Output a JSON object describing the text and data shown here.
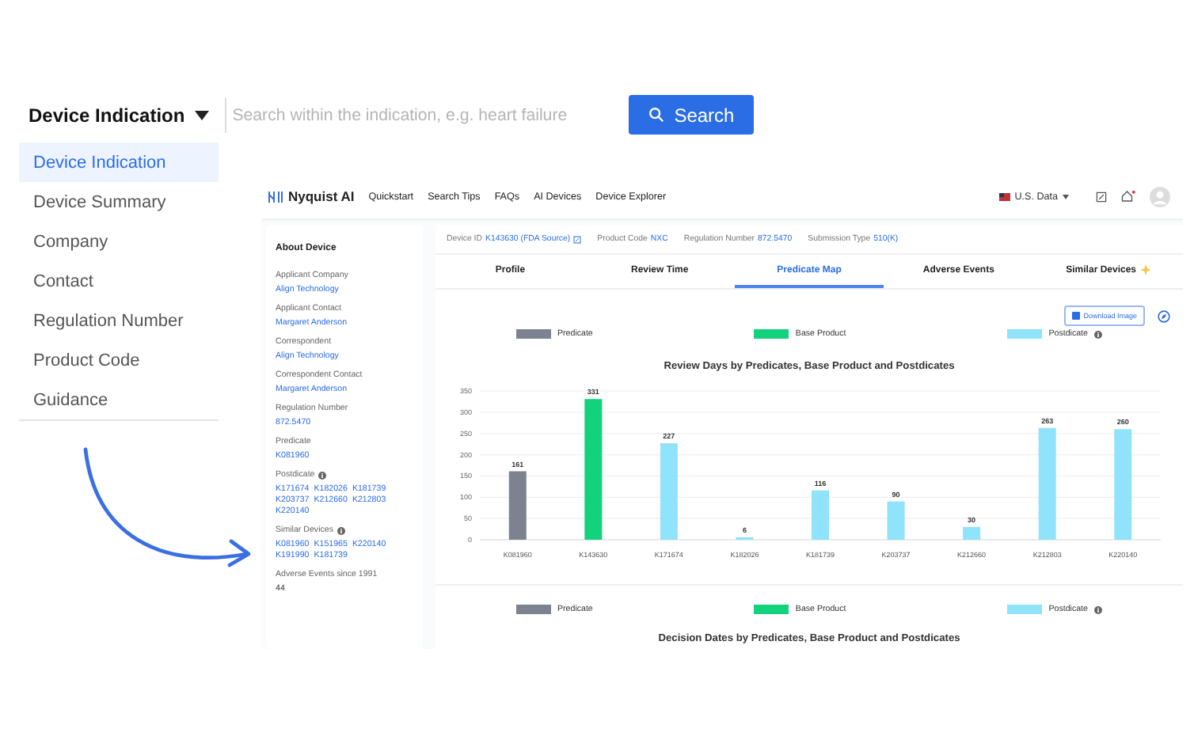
{
  "search_bar": {
    "scope": "Device Indication",
    "placeholder": "Search within the indication, e.g. heart failure",
    "button": "Search"
  },
  "scope_menu": [
    {
      "label": "Device Indication",
      "selected": true
    },
    {
      "label": "Device Summary",
      "selected": false
    },
    {
      "label": "Company",
      "selected": false
    },
    {
      "label": "Contact",
      "selected": false
    },
    {
      "label": "Regulation Number",
      "selected": false
    },
    {
      "label": "Product Code",
      "selected": false
    },
    {
      "label": "Guidance",
      "selected": false
    }
  ],
  "app": {
    "logo": "Nyquist AI",
    "nav": [
      "Quickstart",
      "Search Tips",
      "FAQs",
      "AI Devices",
      "Device Explorer"
    ],
    "region": "U.S. Data",
    "device_bar": [
      {
        "label": "Device ID",
        "value": "K143630 (FDA Source)",
        "external": true
      },
      {
        "label": "Product Code",
        "value": "NXC",
        "external": false
      },
      {
        "label": "Regulation Number",
        "value": "872.5470",
        "external": false
      },
      {
        "label": "Submission Type",
        "value": "510(K)",
        "external": false
      }
    ],
    "tabs": [
      {
        "label": "Profile",
        "selected": false,
        "new": false
      },
      {
        "label": "Review Time",
        "selected": false,
        "new": false
      },
      {
        "label": "Predicate Map",
        "selected": true,
        "new": false
      },
      {
        "label": "Adverse Events",
        "selected": false,
        "new": false
      },
      {
        "label": "Similar Devices",
        "selected": false,
        "new": true
      }
    ],
    "about": {
      "title": "About Device",
      "fields": [
        {
          "label": "Applicant Company",
          "kind": "link",
          "info": false,
          "values": [
            "Align Technology"
          ]
        },
        {
          "label": "Applicant Contact",
          "kind": "link",
          "info": false,
          "values": [
            "Margaret Anderson"
          ]
        },
        {
          "label": "Correspondent",
          "kind": "link",
          "info": false,
          "values": [
            "Align Technology"
          ]
        },
        {
          "label": "Correspondent Contact",
          "kind": "link",
          "info": false,
          "values": [
            "Margaret Anderson"
          ]
        },
        {
          "label": "Regulation Number",
          "kind": "link",
          "info": false,
          "values": [
            "872.5470"
          ]
        },
        {
          "label": "Predicate",
          "kind": "link",
          "info": false,
          "values": [
            "K081960"
          ]
        },
        {
          "label": "Postdicate",
          "kind": "link",
          "info": true,
          "values": [
            "K171674",
            "K182026",
            "K181739",
            "K203737",
            "K212660",
            "K212803",
            "K220140"
          ]
        },
        {
          "label": "Similar Devices",
          "kind": "link",
          "info": true,
          "values": [
            "K081960",
            "K151965",
            "K220140",
            "K191990",
            "K181739"
          ]
        },
        {
          "label": "Adverse Events since 1991",
          "kind": "text",
          "info": false,
          "values": [
            "44"
          ]
        }
      ]
    },
    "download_button": "Download Image",
    "review_chart": {
      "chart_data": {
        "type": "bar",
        "title": "Review Days by Predicates, Base Product and Postdicates",
        "categories": [
          "K081960",
          "K143630",
          "K171674",
          "K182026",
          "K181739",
          "K203737",
          "K212660",
          "K212803",
          "K220140"
        ],
        "stacked": true,
        "grid": true,
        "ylim": [
          0,
          350
        ],
        "yticks": [
          0,
          50,
          100,
          150,
          200,
          250,
          300,
          350
        ],
        "data_labels": true,
        "series": [
          {
            "name": "Predicate",
            "color": "#7d8291",
            "values": [
              161,
              null,
              null,
              null,
              null,
              null,
              null,
              null,
              null
            ]
          },
          {
            "name": "Base Product",
            "color": "#12d37c",
            "values": [
              null,
              331,
              null,
              null,
              null,
              null,
              null,
              null,
              null
            ]
          },
          {
            "name": "Postdicate",
            "color": "#8fe3fb",
            "values": [
              null,
              null,
              227,
              6,
              116,
              90,
              30,
              263,
              260
            ]
          }
        ]
      },
      "legend_info": [
        false,
        false,
        true
      ]
    },
    "decision_chart": {
      "title": "Decision Dates by Predicates, Base Product and Postdicates",
      "legend": [
        {
          "label": "Predicate",
          "color": "#7d8291",
          "info": false
        },
        {
          "label": "Base Product",
          "color": "#12d37c",
          "info": false
        },
        {
          "label": "Postdicate",
          "color": "#8fe3fb",
          "info": true
        }
      ]
    }
  }
}
